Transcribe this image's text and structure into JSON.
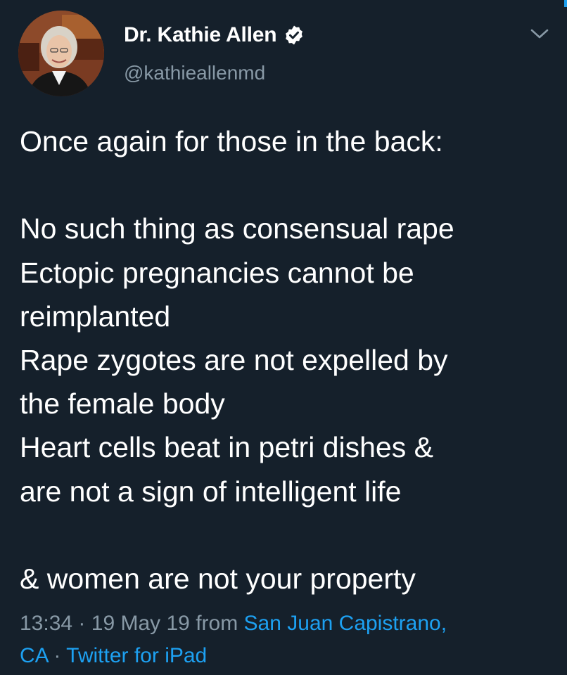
{
  "author": {
    "display_name": "Dr. Kathie Allen",
    "handle": "@kathieallenmd",
    "verified": true,
    "avatar_icon": "profile-photo"
  },
  "tweet": {
    "lines": [
      "Once again for those in the back:",
      "",
      "No such thing as consensual rape",
      "Ectopic pregnancies cannot be",
      "reimplanted",
      "Rape zygotes are not expelled by",
      "the female body",
      "Heart cells beat in petri dishes &",
      "are not a sign of intelligent life",
      "",
      "& women are not your property"
    ]
  },
  "meta": {
    "time": "13:34",
    "separator": "·",
    "date": "19 May 19",
    "from_label": "from",
    "location_line1": "San Juan Capistrano,",
    "location_line2": "CA",
    "source": "Twitter for iPad"
  },
  "icons": {
    "verified": "verified-badge-icon",
    "menu": "chevron-down-icon"
  },
  "colors": {
    "background": "#15202b",
    "text": "#ffffff",
    "secondary": "#8899a6",
    "link": "#1da1f2"
  }
}
